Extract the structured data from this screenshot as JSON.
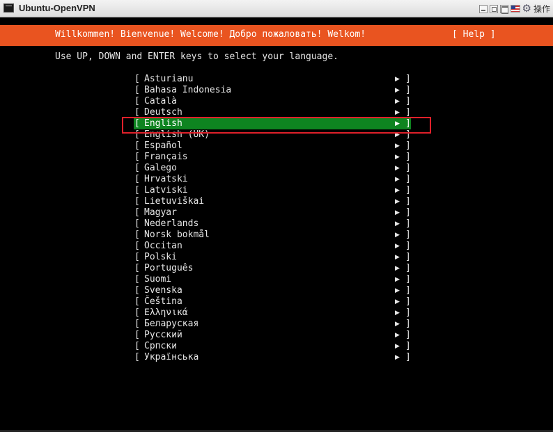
{
  "window": {
    "title": "Ubuntu-OpenVPN",
    "controls": [
      "minimize-icon",
      "restore-icon",
      "maximize-icon",
      "flag-icon",
      "gear-icon"
    ],
    "operate_label": "操作"
  },
  "installer": {
    "banner": "Willkommen! Bienvenue! Welcome! Добро пожаловать! Welkom!",
    "help_label": "[ Help ]",
    "instructions": "Use UP, DOWN and ENTER keys to select your language.",
    "selected_language": "English",
    "accent_color": "#e95420",
    "selection_color": "#0e8420",
    "languages": [
      {
        "label": "Asturianu"
      },
      {
        "label": "Bahasa Indonesia"
      },
      {
        "label": "Català"
      },
      {
        "label": "Deutsch"
      },
      {
        "label": "English"
      },
      {
        "label": "English (UK)"
      },
      {
        "label": "Español"
      },
      {
        "label": "Français"
      },
      {
        "label": "Galego"
      },
      {
        "label": "Hrvatski"
      },
      {
        "label": "Latviski"
      },
      {
        "label": "Lietuviškai"
      },
      {
        "label": "Magyar"
      },
      {
        "label": "Nederlands"
      },
      {
        "label": "Norsk bokmål"
      },
      {
        "label": "Occitan"
      },
      {
        "label": "Polski"
      },
      {
        "label": "Português"
      },
      {
        "label": "Suomi"
      },
      {
        "label": "Svenska"
      },
      {
        "label": "Čeština"
      },
      {
        "label": "Ελληνικά"
      },
      {
        "label": "Беларуская"
      },
      {
        "label": "Русский"
      },
      {
        "label": "Српски"
      },
      {
        "label": "Українська"
      }
    ]
  }
}
